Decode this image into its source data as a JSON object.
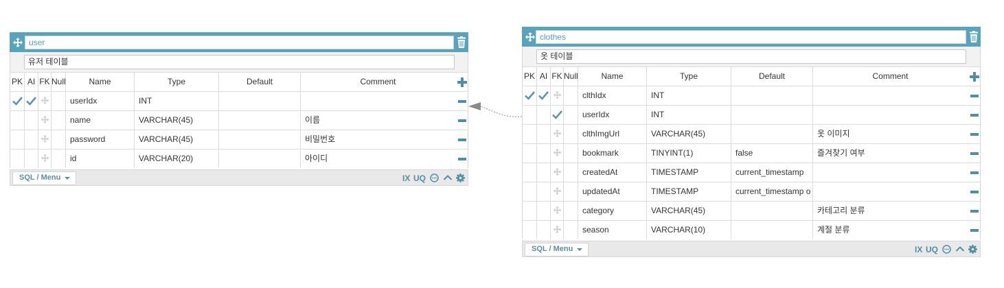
{
  "columns_header": {
    "pk": "PK",
    "ai": "AI",
    "fk": "FK",
    "null": "Null",
    "name": "Name",
    "type": "Type",
    "default": "Default",
    "comment": "Comment"
  },
  "footer": {
    "menu_label": "SQL / Menu",
    "ix_label": "IX",
    "uq_label": "UQ"
  },
  "icons": {
    "move": "move-icon",
    "trash": "trash-icon",
    "check": "check-icon",
    "add": "plus-icon",
    "remove": "minus-icon",
    "comment": "comment-icon",
    "collapse": "chevron-up-icon",
    "settings": "gear-icon"
  },
  "colors": {
    "header": "#58a4bd",
    "accent": "#4e8fa8",
    "check": "#5a95ad",
    "relation_line": "#8a8a8a"
  },
  "user_table": {
    "name": "user",
    "comment": "유저 테이블",
    "columns": [
      {
        "pk": true,
        "ai": true,
        "fk": false,
        "name": "userIdx",
        "type": "INT",
        "default": "",
        "comment": ""
      },
      {
        "pk": false,
        "ai": false,
        "fk": false,
        "name": "name",
        "type": "VARCHAR(45)",
        "default": "",
        "comment": "이름"
      },
      {
        "pk": false,
        "ai": false,
        "fk": false,
        "name": "password",
        "type": "VARCHAR(45)",
        "default": "",
        "comment": "비밀번호"
      },
      {
        "pk": false,
        "ai": false,
        "fk": false,
        "name": "id",
        "type": "VARCHAR(20)",
        "default": "",
        "comment": "아이디"
      }
    ]
  },
  "clothes_table": {
    "name": "clothes",
    "comment": "옷 테이블",
    "columns": [
      {
        "pk": true,
        "ai": true,
        "fk": false,
        "name": "clthIdx",
        "type": "INT",
        "default": "",
        "comment": ""
      },
      {
        "pk": false,
        "ai": false,
        "fk": true,
        "name": "userIdx",
        "type": "INT",
        "default": "",
        "comment": ""
      },
      {
        "pk": false,
        "ai": false,
        "fk": false,
        "name": "clthImgUrl",
        "type": "VARCHAR(45)",
        "default": "",
        "comment": "옷 이미지"
      },
      {
        "pk": false,
        "ai": false,
        "fk": false,
        "name": "bookmark",
        "type": "TINYINT(1)",
        "default": "false",
        "comment": "즐겨찾기 여부"
      },
      {
        "pk": false,
        "ai": false,
        "fk": false,
        "name": "createdAt",
        "type": "TIMESTAMP",
        "default": "current_timestamp",
        "comment": ""
      },
      {
        "pk": false,
        "ai": false,
        "fk": false,
        "name": "updatedAt",
        "type": "TIMESTAMP",
        "default": "current_timestamp o",
        "comment": ""
      },
      {
        "pk": false,
        "ai": false,
        "fk": false,
        "name": "category",
        "type": "VARCHAR(45)",
        "default": "",
        "comment": "카테고리 분류"
      },
      {
        "pk": false,
        "ai": false,
        "fk": false,
        "name": "season",
        "type": "VARCHAR(10)",
        "default": "",
        "comment": "계절 분류"
      }
    ]
  }
}
